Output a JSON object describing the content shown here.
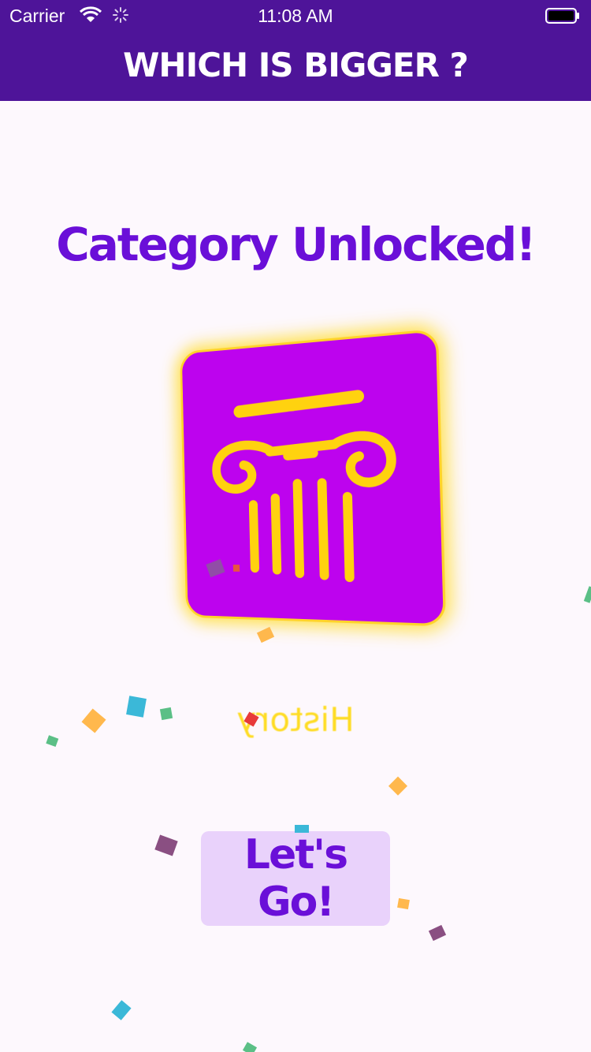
{
  "status_bar": {
    "carrier": "Carrier",
    "time": "11:08 AM"
  },
  "nav": {
    "title": "WHICH IS BIGGER ?"
  },
  "content": {
    "headline": "Category Unlocked!",
    "category_icon": "column-icon",
    "category_name": "History",
    "button_label": "Let's Go!"
  },
  "colors": {
    "nav_background": "#4e1499",
    "headline": "#6a0fd8",
    "card_background": "#bd03ee",
    "card_accent": "#ffd32a",
    "button_background": "#e9d2fb"
  }
}
